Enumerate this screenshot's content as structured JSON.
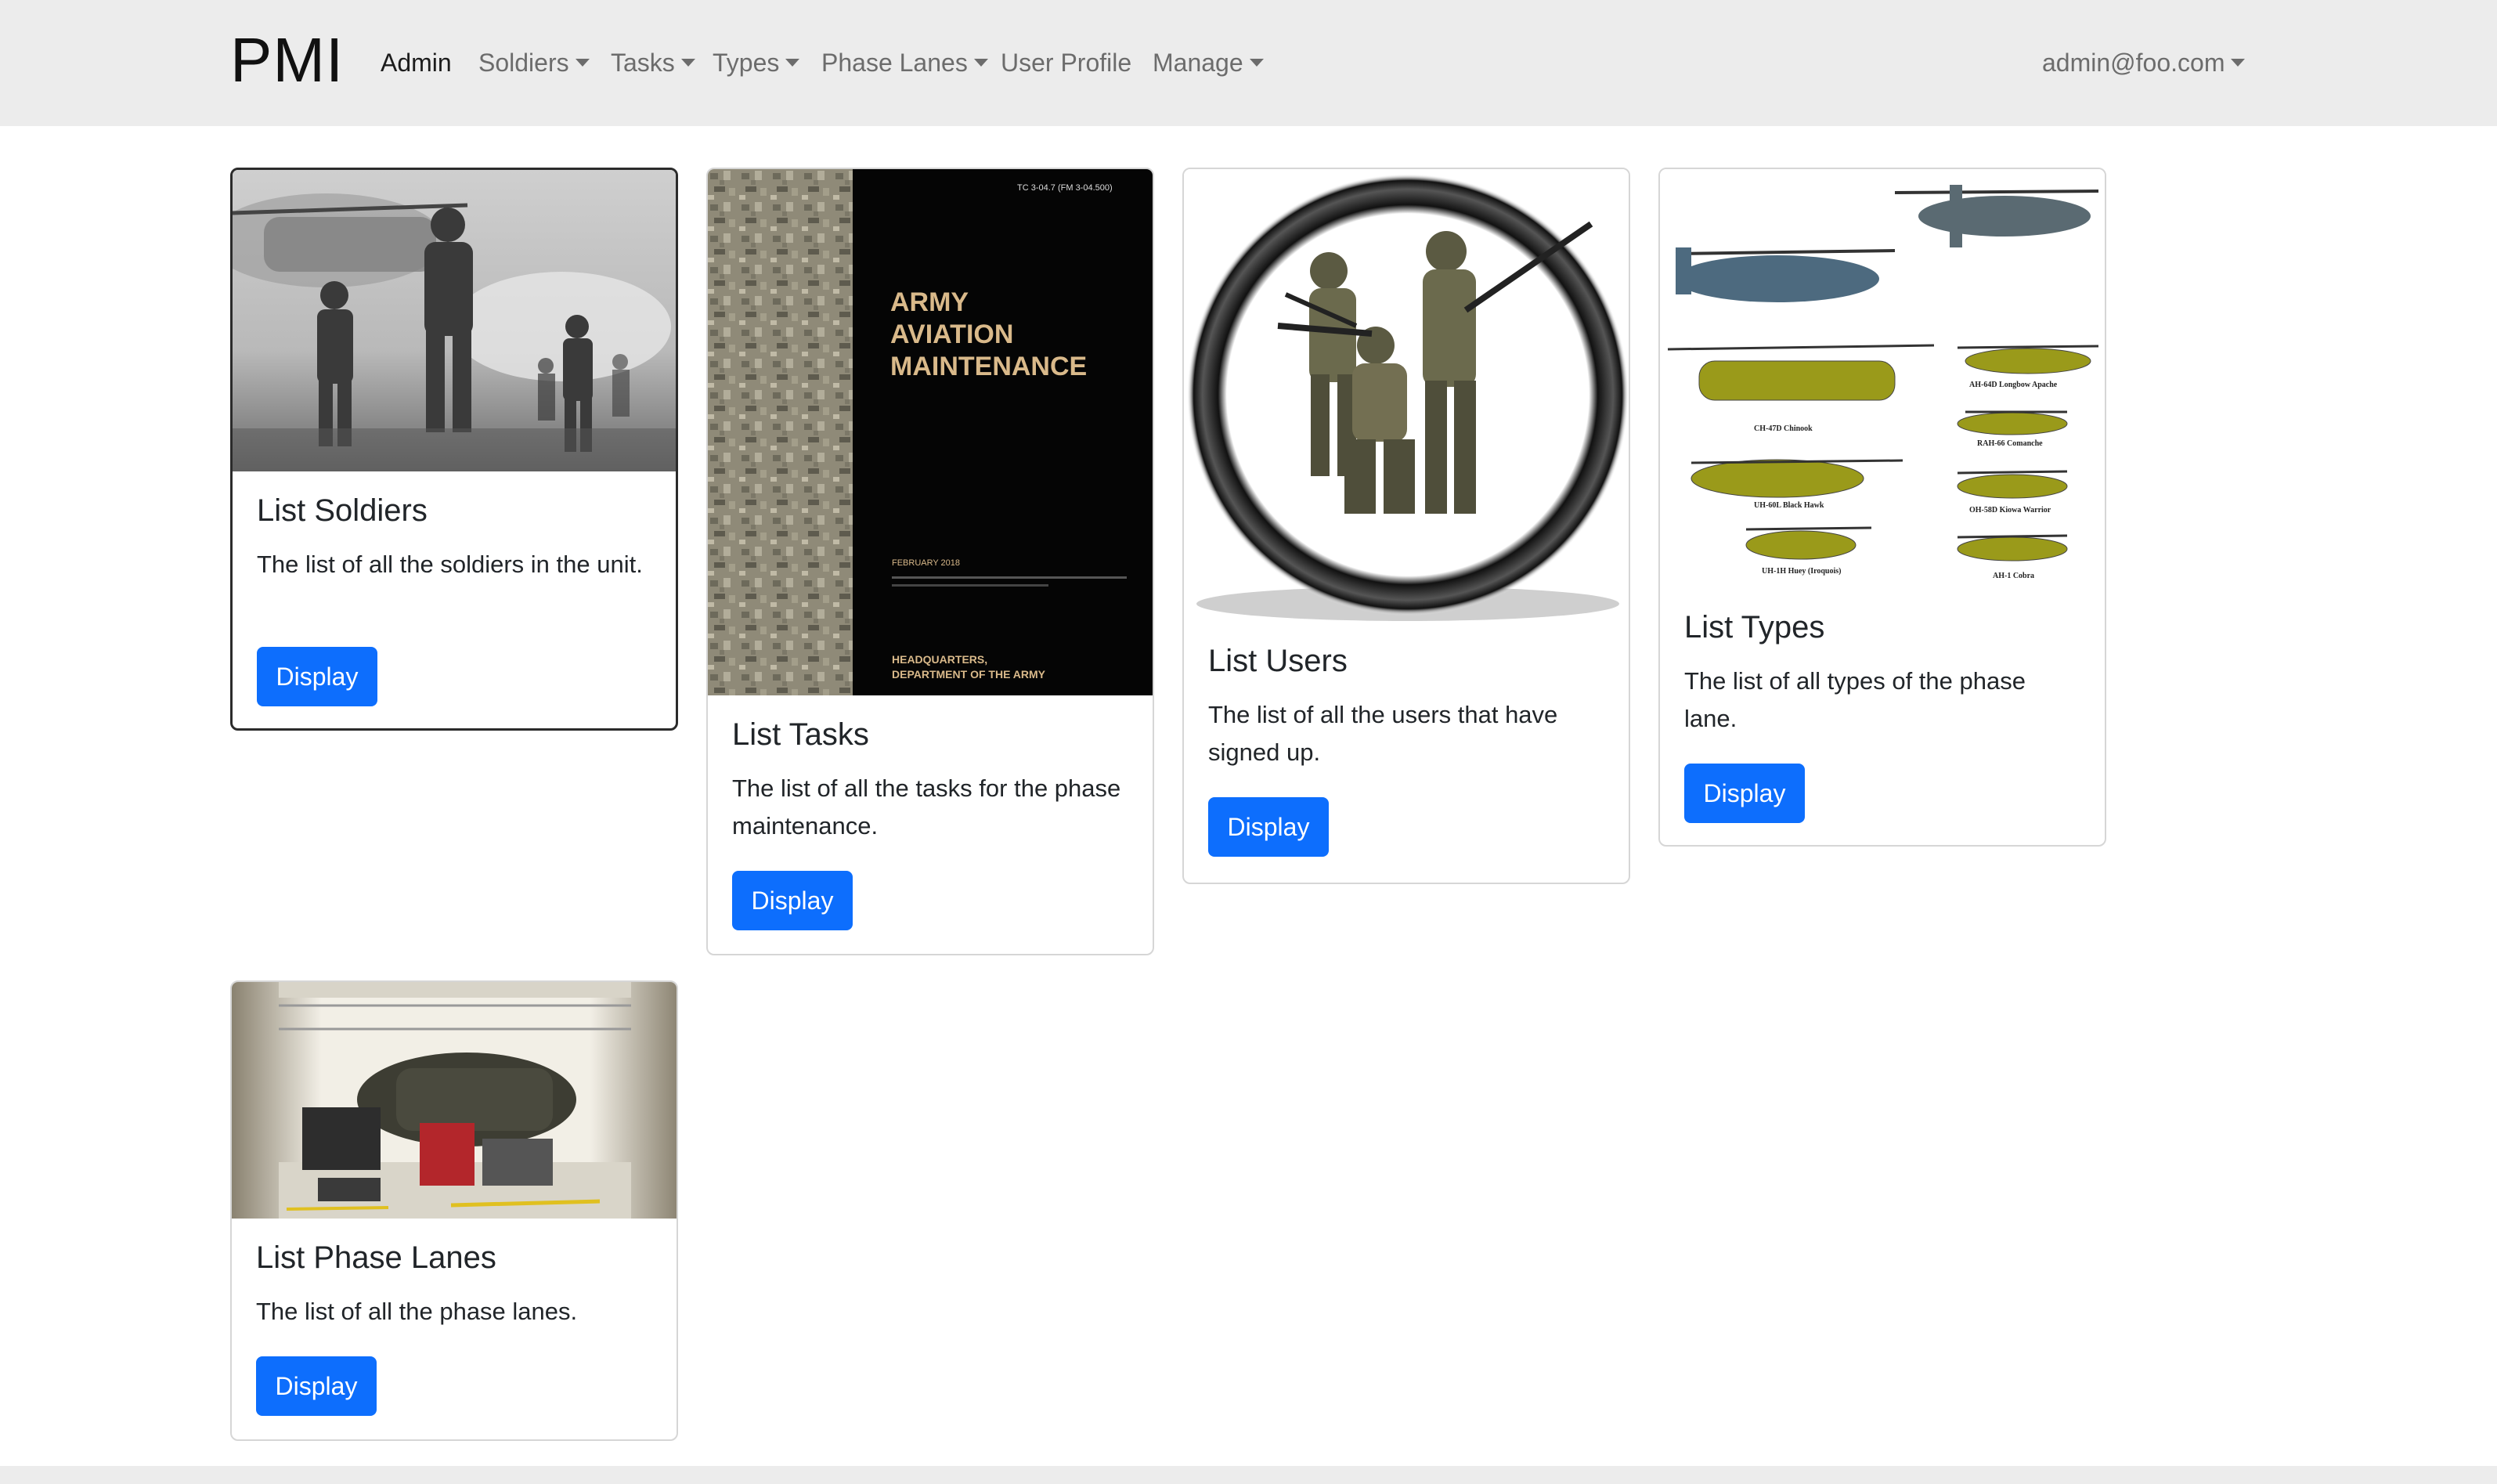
{
  "navbar": {
    "brand": "PMI",
    "items": [
      {
        "label": "Admin",
        "active": true,
        "dropdown": false
      },
      {
        "label": "Soldiers",
        "active": false,
        "dropdown": true
      },
      {
        "label": "Tasks",
        "active": false,
        "dropdown": true
      },
      {
        "label": "Types",
        "active": false,
        "dropdown": true
      },
      {
        "label": "Phase Lanes",
        "active": false,
        "dropdown": true
      },
      {
        "label": "User Profile",
        "active": false,
        "dropdown": false
      },
      {
        "label": "Manage",
        "active": false,
        "dropdown": true
      }
    ],
    "user": "admin@foo.com"
  },
  "cards": [
    {
      "title": "List Soldiers",
      "text": "The list of all the soldiers in the unit.",
      "button": "Display",
      "image": "soldiers-photo"
    },
    {
      "title": "List Tasks",
      "text": "The list of all the tasks for the phase maintenance.",
      "button": "Display",
      "image": "army-aviation-maintenance-cover"
    },
    {
      "title": "List Users",
      "text": "The list of all the users that have signed up.",
      "button": "Display",
      "image": "soldiers-circle-icon"
    },
    {
      "title": "List Types",
      "text": "The list of all types of the phase lane.",
      "button": "Display",
      "image": "helicopter-types-chart"
    },
    {
      "title": "List Phase Lanes",
      "text": "The list of all the phase lanes.",
      "button": "Display",
      "image": "hangar-photo"
    }
  ],
  "book_cover": {
    "code": "TC 3-04.7 (FM 3-04.500)",
    "title_line1": "ARMY",
    "title_line2": "AVIATION",
    "title_line3": "MAINTENANCE",
    "date": "FEBRUARY 2018",
    "hq_line1": "HEADQUARTERS,",
    "hq_line2": "DEPARTMENT OF THE ARMY"
  },
  "helicopter_labels": [
    "AH-64D Longbow Apache",
    "CH-47D Chinook",
    "RAH-66 Comanche",
    "UH-60L Black Hawk",
    "OH-58D Kiowa Warrior",
    "UH-1H Huey (Iroquois)",
    "AH-1 Cobra"
  ],
  "colors": {
    "navbar_bg": "#ececec",
    "primary_button": "#0d6efd",
    "card_border": "#d6d6d6"
  }
}
